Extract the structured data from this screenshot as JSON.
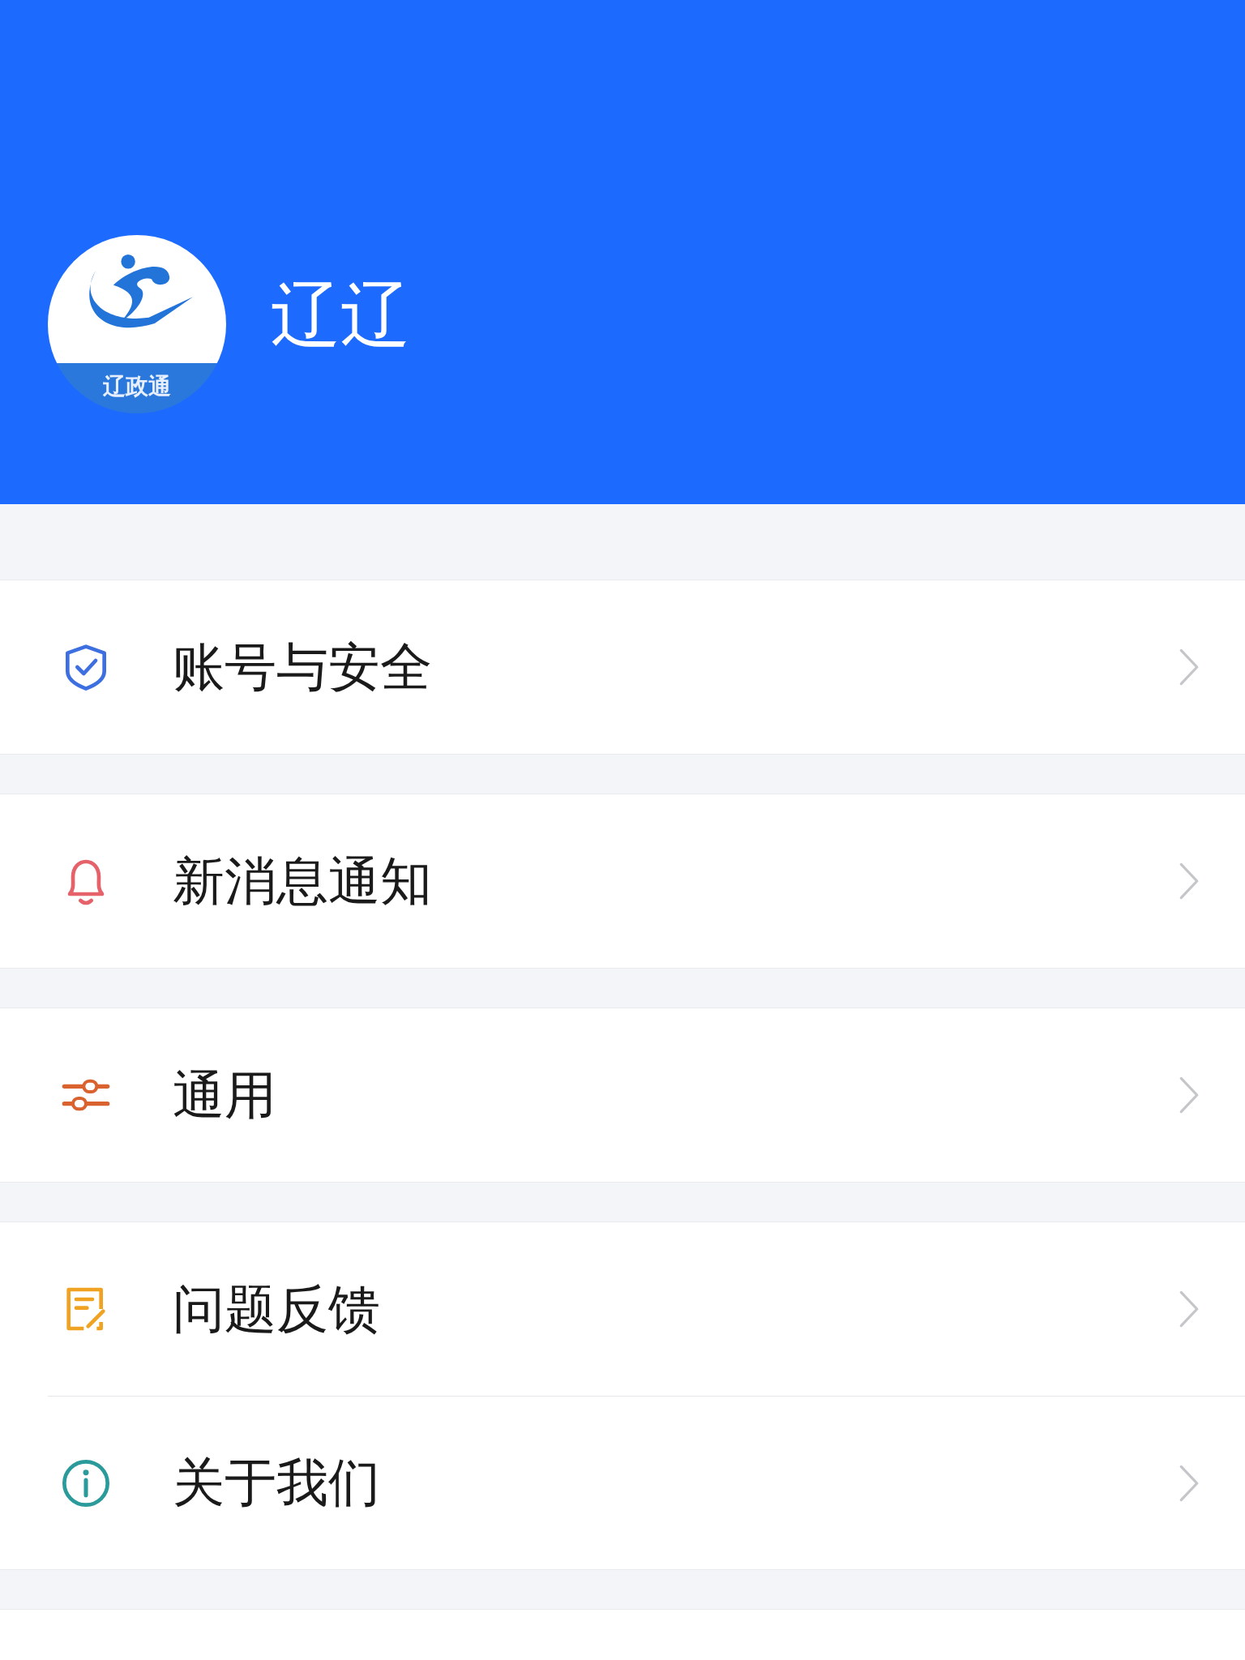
{
  "profile": {
    "logo_text": "辽政通",
    "name": "辽辽"
  },
  "groups": [
    {
      "items": [
        {
          "kind": "shield",
          "color": "#3d6fe0",
          "label": "账号与安全"
        }
      ]
    },
    {
      "items": [
        {
          "kind": "bell",
          "color": "#e5626a",
          "label": "新消息通知"
        }
      ]
    },
    {
      "items": [
        {
          "kind": "sliders",
          "color": "#d9622f",
          "label": "通用"
        }
      ]
    },
    {
      "items": [
        {
          "kind": "note",
          "color": "#f0a323",
          "label": "问题反馈"
        },
        {
          "kind": "info",
          "color": "#2a9a9a",
          "label": "关于我们"
        }
      ]
    }
  ]
}
